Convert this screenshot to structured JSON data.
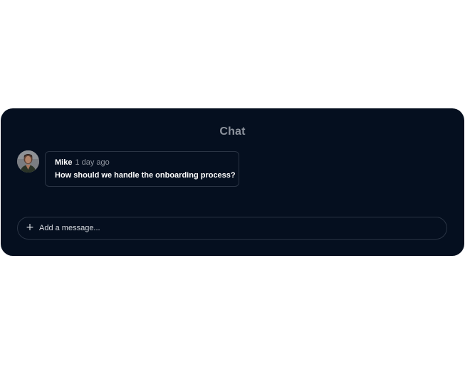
{
  "chat": {
    "title": "Chat",
    "messages": [
      {
        "author": "Mike",
        "time": "1 day ago",
        "text": "How should we handle the onboarding process?"
      }
    ],
    "composer": {
      "placeholder": "Add a message...",
      "value": "",
      "add_icon": "plus-icon"
    }
  },
  "colors": {
    "card_background": "#050f1f",
    "border": "#2a3444",
    "muted_text": "#8d939d",
    "primary_text": "#ffffff"
  }
}
